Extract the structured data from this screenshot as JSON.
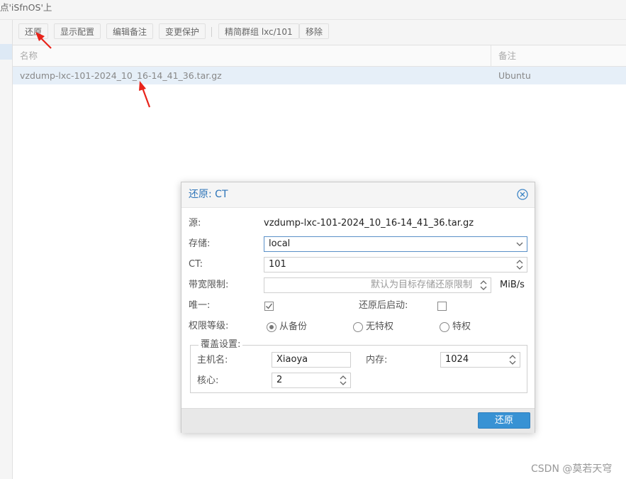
{
  "window": {
    "title": "点'iSfnOS'上"
  },
  "toolbar": {
    "restore": "还原",
    "show_config": "显示配置",
    "edit_notes": "编辑备注",
    "change_protection": "变更保护",
    "prune_group": "精简群组 lxc/101",
    "remove": "移除"
  },
  "grid": {
    "columns": [
      "名称",
      "备注"
    ],
    "rows": [
      {
        "name": "vzdump-lxc-101-2024_10_16-14_41_36.tar.gz",
        "notes": "Ubuntu"
      }
    ]
  },
  "dialog": {
    "title": "还原: CT",
    "source_label": "源:",
    "source_value": "vzdump-lxc-101-2024_10_16-14_41_36.tar.gz",
    "storage_label": "存储:",
    "storage_value": "local",
    "ct_label": "CT:",
    "ct_value": "101",
    "bwlimit_label": "带宽限制:",
    "bwlimit_placeholder": "默认为目标存储还原限制",
    "bwlimit_unit": "MiB/s",
    "unique_label": "唯一:",
    "unique_checked": true,
    "start_after_label": "还原后启动:",
    "start_after_checked": false,
    "privilege_label": "权限等级:",
    "privilege_options": [
      "从备份",
      "无特权",
      "特权"
    ],
    "privilege_selected": "从备份",
    "override_legend": "覆盖设置:",
    "hostname_label": "主机名:",
    "hostname_value": "Xiaoya",
    "memory_label": "内存:",
    "memory_value": "1024",
    "cores_label": "核心:",
    "cores_value": "2",
    "restore_button": "还原"
  },
  "colors": {
    "accent": "#3892d4",
    "title_blue": "#2d74b8",
    "arrow_red": "#e8231a",
    "selected_row": "#e6eff8"
  },
  "watermark": "CSDN @莫若天穹"
}
